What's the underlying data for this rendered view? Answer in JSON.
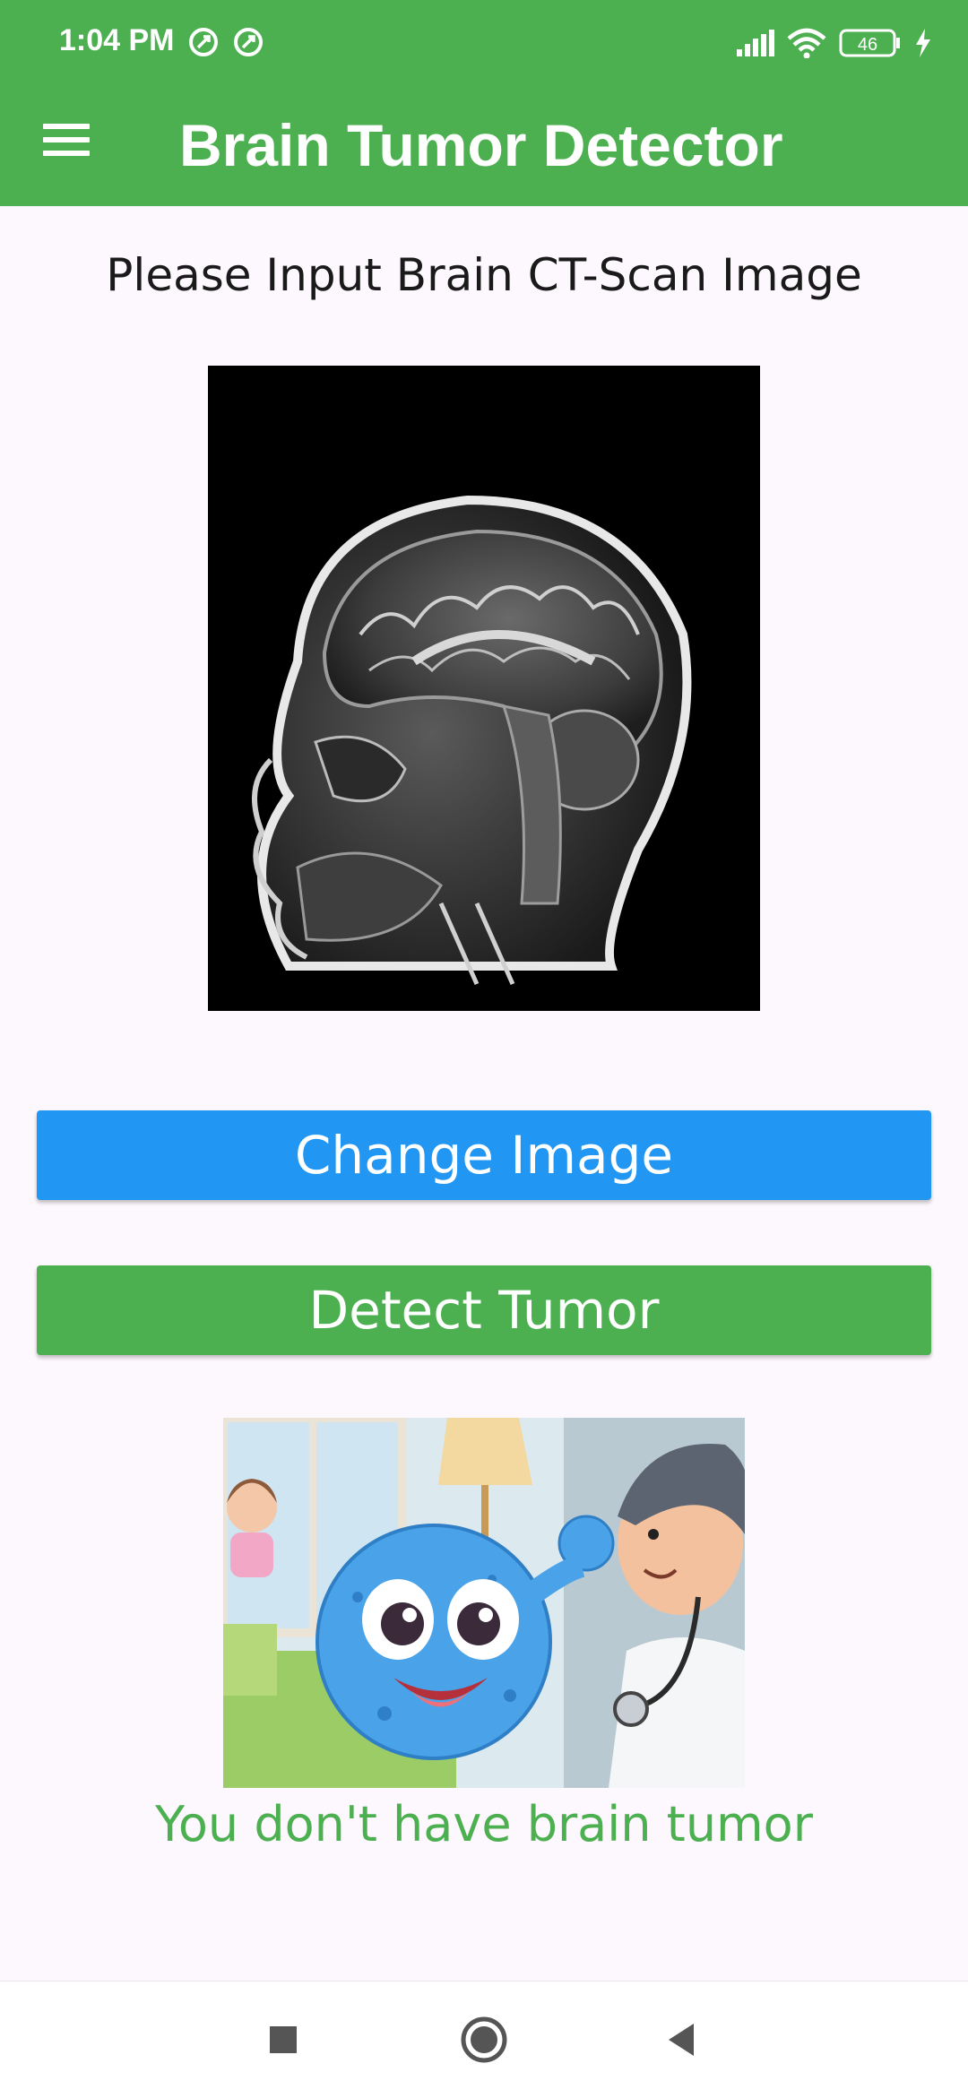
{
  "status_bar": {
    "time": "1:04 PM",
    "battery": "46",
    "icons": [
      "app-notification-icon",
      "app-notification-icon",
      "signal-icon",
      "wifi-icon",
      "battery-icon",
      "charging-icon"
    ]
  },
  "app_bar": {
    "title": "Brain Tumor Detector",
    "menu_icon": "menu-icon"
  },
  "main": {
    "prompt": "Please Input Brain CT-Scan Image",
    "change_image_label": "Change Image",
    "detect_tumor_label": "Detect Tumor",
    "result_text": "You don't have brain tumor"
  },
  "colors": {
    "primary_green": "#4caf50",
    "button_blue": "#2196f3",
    "background": "#fdf8fd"
  },
  "nav_bar": {
    "icons": [
      "recents-square-icon",
      "home-circle-icon",
      "back-triangle-icon"
    ]
  }
}
